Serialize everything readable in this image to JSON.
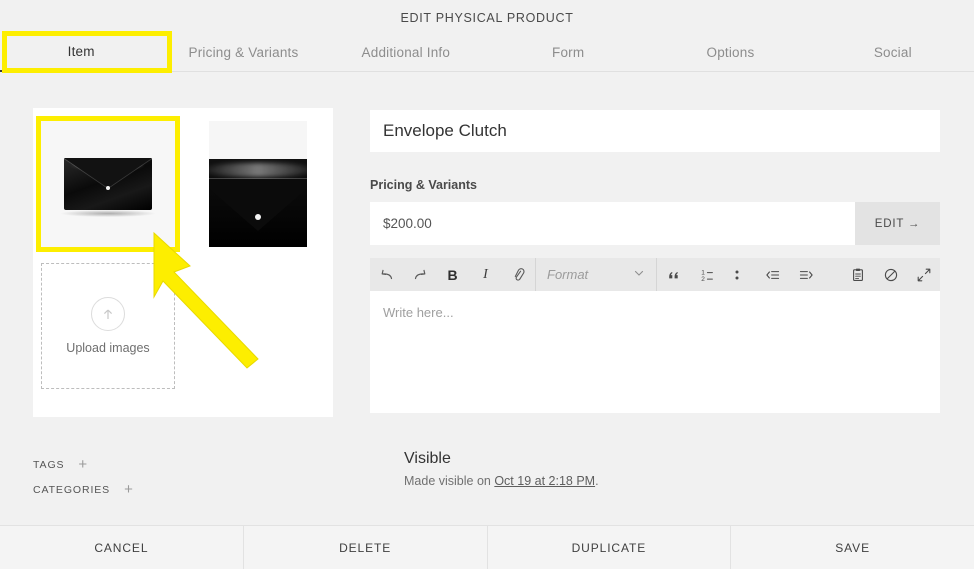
{
  "header": {
    "title": "EDIT PHYSICAL PRODUCT"
  },
  "tabs": [
    {
      "label": "Item",
      "active": true
    },
    {
      "label": "Pricing & Variants",
      "active": false
    },
    {
      "label": "Additional Info",
      "active": false
    },
    {
      "label": "Form",
      "active": false
    },
    {
      "label": "Options",
      "active": false
    },
    {
      "label": "Social",
      "active": false
    }
  ],
  "images": {
    "thumbnails": [
      {
        "alt": "Black envelope clutch product photo",
        "selected": true
      },
      {
        "alt": "Black envelope clutch closeup",
        "selected": false
      }
    ],
    "upload": {
      "label": "Upload images",
      "icon": "upload-arrow-icon"
    }
  },
  "meta": {
    "tags_label": "TAGS",
    "categories_label": "CATEGORIES",
    "add_icon": "+"
  },
  "product": {
    "title_value": "Envelope Clutch",
    "title_placeholder": "Product name",
    "pricing_section_label": "Pricing & Variants",
    "price_value": "$200.00",
    "edit_label": "EDIT →"
  },
  "editor": {
    "placeholder": "Write here...",
    "format_label": "Format",
    "toolbar": [
      {
        "name": "undo-icon",
        "glyph": "undo"
      },
      {
        "name": "redo-icon",
        "glyph": "redo"
      },
      {
        "name": "bold-icon",
        "glyph": "B"
      },
      {
        "name": "italic-icon",
        "glyph": "I"
      },
      {
        "name": "link-icon",
        "glyph": "link"
      },
      {
        "name": "blockquote-icon",
        "glyph": "“"
      },
      {
        "name": "ordered-list-icon",
        "glyph": "ol"
      },
      {
        "name": "bulleted-list-icon",
        "glyph": "ul"
      },
      {
        "name": "outdent-icon",
        "glyph": "outdent"
      },
      {
        "name": "indent-icon",
        "glyph": "indent"
      },
      {
        "name": "paste-icon",
        "glyph": "clipboard"
      },
      {
        "name": "clear-formatting-icon",
        "glyph": "⊘"
      },
      {
        "name": "fullscreen-icon",
        "glyph": "expand"
      }
    ]
  },
  "visibility": {
    "status": "Visible",
    "made_visible_prefix": "Made visible on ",
    "date": "Oct 19 at 2:18 PM",
    "suffix": "."
  },
  "actions": [
    {
      "label": "CANCEL"
    },
    {
      "label": "DELETE"
    },
    {
      "label": "DUPLICATE"
    },
    {
      "label": "SAVE"
    }
  ],
  "annotations": {
    "highlight_color": "#fdee00",
    "items": [
      {
        "name": "highlight-box-item-tab",
        "target": "tab-item"
      },
      {
        "name": "highlight-box-first-thumbnail",
        "target": "thumbnail-1"
      },
      {
        "name": "pointer-arrow",
        "target": "thumbnail-1"
      }
    ]
  }
}
